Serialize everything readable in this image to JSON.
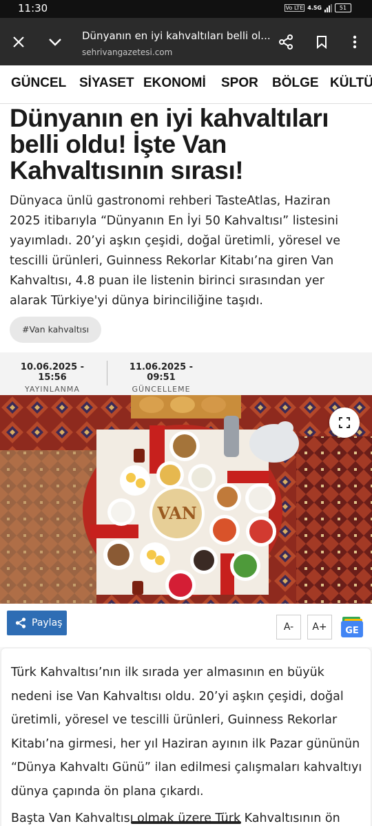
{
  "status_bar": {
    "time": "11:30",
    "volte": "Vo LTE",
    "network": "4.5G",
    "battery": "51"
  },
  "browser": {
    "title": "Dünyanın en iyi kahvaltıları belli ol...",
    "domain": "sehrivangazetesi.com"
  },
  "nav": {
    "items": [
      "GÜNCEL",
      "SİYASET",
      "EKONOMİ",
      "SPOR",
      "BÖLGE",
      "KÜLTÜR"
    ]
  },
  "article": {
    "headline": "Dünyanın en iyi kahvaltıları belli oldu! İşte Van Kahvaltısının sırası!",
    "lede": "Dünyaca ünlü gastronomi rehberi TasteAtlas, Haziran 2025 itibarıyla “Dünyanın En İyi 50 Kahvaltısı” listesini yayımladı. 20’yi aşkın çeşidi, doğal üretimli, yöresel ve tescilli ürünleri, Guinness Rekorlar Kitabı’na giren Van Kahvaltısı, 4.8 puan ile listenin birinci sırasından yer alarak Türkiye'yi dünya birinciliğine taşıdı.",
    "tag": "#Van kahvaltısı",
    "published": {
      "date": "10.06.2025 - 15:56",
      "label": "YAYINLANMA"
    },
    "updated": {
      "date": "11.06.2025 - 09:51",
      "label": "GÜNCELLEME"
    },
    "hero_plate_text": "VAN",
    "share_label": "Paylaş",
    "font_decrease": "A-",
    "font_increase": "A+",
    "body_p1": "Türk Kahvaltısı’nın ilk sırada yer almasının en büyük nedeni ise Van Kahvaltısı oldu. 20’yi aşkın çeşidi, doğal üretimli, yöresel ve tescilli ürünleri, Guinness Rekorlar Kitabı’na girmesi, her yıl Haziran ayının ilk Pazar gününün “Dünya Kahvaltı Günü” ilan edilmesi çalışmaları kahvaltıyı dünya çapında ön plana çıkardı.",
    "body_p2": "Başta Van Kahvaltısı olmak üzere Türk Kahvaltısının ön"
  },
  "colors": {
    "topbar": "#2b2b2b",
    "share_button": "#2e6db4",
    "carpet_red": "#9b2a1f"
  },
  "icons": {
    "close": "close-icon",
    "collapse": "chevron-down-icon",
    "share": "share-icon",
    "bookmark": "bookmark-icon",
    "menu": "more-vert-icon",
    "expand": "fullscreen-icon",
    "google_news": "google-news-icon"
  }
}
